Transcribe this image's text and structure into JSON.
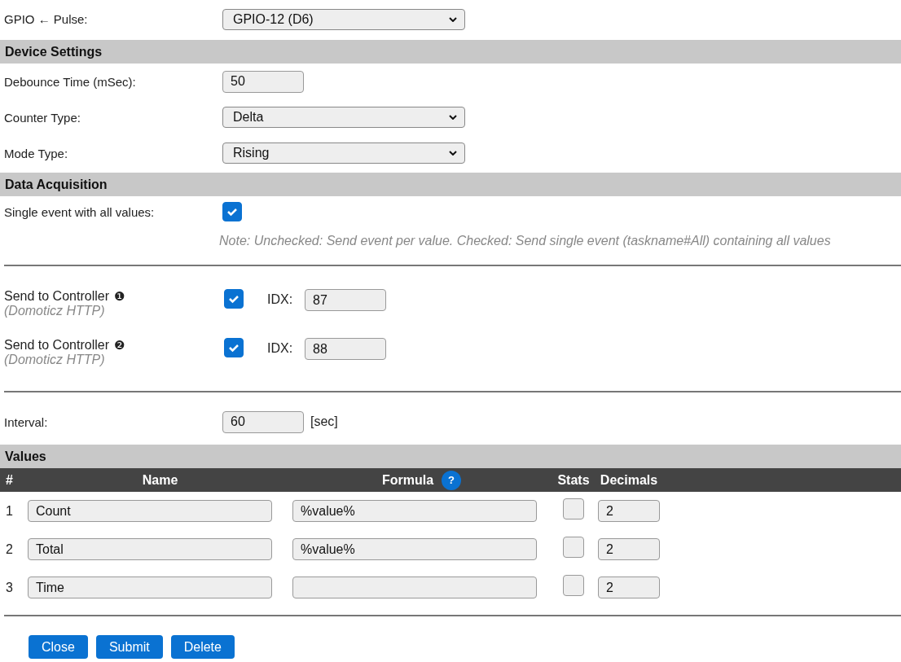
{
  "top_rows": [
    {
      "kind": "select",
      "label": "GPIO ← Pulse:",
      "value": "GPIO-12 (D6)"
    }
  ],
  "device_settings": {
    "title": "Device Settings",
    "rows": [
      {
        "kind": "number",
        "label": "Debounce Time (mSec):",
        "value": "50"
      },
      {
        "kind": "select",
        "label": "Counter Type:",
        "value": "Delta"
      },
      {
        "kind": "select",
        "label": "Mode Type:",
        "value": "Rising"
      }
    ]
  },
  "data_acquisition": {
    "title": "Data Acquisition",
    "single_event": {
      "label": "Single event with all values:",
      "checked": true
    },
    "note": "Note: Unchecked: Send event per value. Checked: Send single event (taskname#All) containing all values",
    "controllers": [
      {
        "label": "Send to Controller",
        "badge": "❶",
        "sublabel": "(Domoticz HTTP)",
        "checked": true,
        "idx_label": "IDX:",
        "idx": "87"
      },
      {
        "label": "Send to Controller",
        "badge": "❷",
        "sublabel": "(Domoticz HTTP)",
        "checked": true,
        "idx_label": "IDX:",
        "idx": "88"
      }
    ],
    "interval": {
      "label": "Interval:",
      "value": "60",
      "unit": "[sec]"
    }
  },
  "values": {
    "title": "Values",
    "columns": [
      "#",
      "Name",
      "Formula",
      "Stats",
      "Decimals"
    ],
    "formula_help": "?",
    "rows": [
      {
        "index": "1",
        "name": "Count",
        "formula": "%value%",
        "stats": false,
        "decimals": "2"
      },
      {
        "index": "2",
        "name": "Total",
        "formula": "%value%",
        "stats": false,
        "decimals": "2"
      },
      {
        "index": "3",
        "name": "Time",
        "formula": "",
        "stats": false,
        "decimals": "2"
      }
    ]
  },
  "buttons": [
    "Close",
    "Submit",
    "Delete"
  ]
}
